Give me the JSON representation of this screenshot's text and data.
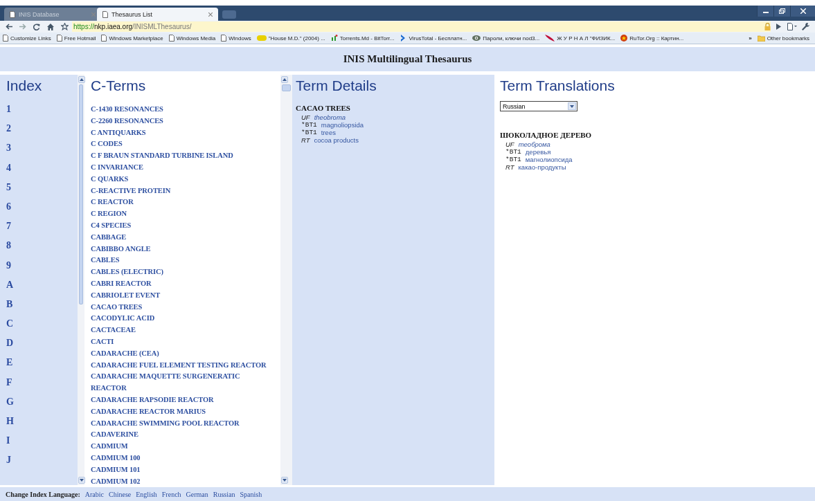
{
  "browser": {
    "tabs": [
      {
        "label": "INIS Database",
        "selected": false
      },
      {
        "label": "Thesaurus List",
        "selected": true
      }
    ],
    "address": {
      "scheme": "https://",
      "host": "nkp.iaea.org",
      "path": "/INISMLThesaurus/"
    },
    "bookmarks": [
      {
        "label": "Customize Links",
        "kind": "page"
      },
      {
        "label": "Free Hotmail",
        "kind": "page"
      },
      {
        "label": "Windows Marketplace",
        "kind": "page"
      },
      {
        "label": "Windows Media",
        "kind": "page"
      },
      {
        "label": "Windows",
        "kind": "page"
      },
      {
        "label": "\"House M.D.\" (2004) ...",
        "kind": "badge",
        "color": "#e8d000"
      },
      {
        "label": "Torrents.Md - BitTorr...",
        "kind": "md",
        "color": "#2a9a2a"
      },
      {
        "label": "VirusTotal - Бесплатн...",
        "kind": "chevron",
        "color": "#1a6ad0"
      },
      {
        "label": "Пароли, ключи nod3...",
        "kind": "eye",
        "color": "#607060"
      },
      {
        "label": "Ж У Р Н А Л \"ФИЗИК...",
        "kind": "feather",
        "color": "#c0103a"
      },
      {
        "label": "RuTor.Org :: Картин...",
        "kind": "star",
        "color": "#d04010"
      }
    ],
    "overflow": "»",
    "other_bookmarks": "Other bookmarks"
  },
  "page": {
    "title": "INIS Multilingual Thesaurus",
    "index": {
      "heading": "Index",
      "items": [
        "1",
        "2",
        "3",
        "4",
        "5",
        "6",
        "7",
        "8",
        "9",
        "A",
        "B",
        "C",
        "D",
        "E",
        "F",
        "G",
        "H",
        "I",
        "J"
      ]
    },
    "terms": {
      "heading": "C-Terms",
      "items": [
        {
          "label": "C-1430 RESONANCES",
          "selected": false
        },
        {
          "label": "C-2260 RESONANCES",
          "selected": false
        },
        {
          "label": "C ANTIQUARKS",
          "selected": false
        },
        {
          "label": "C CODES",
          "selected": false
        },
        {
          "label": "C F BRAUN STANDARD TURBINE ISLAND",
          "selected": false
        },
        {
          "label": "C INVARIANCE",
          "selected": false
        },
        {
          "label": "C QUARKS",
          "selected": false
        },
        {
          "label": "C-REACTIVE PROTEIN",
          "selected": false
        },
        {
          "label": "C REACTOR",
          "selected": false
        },
        {
          "label": "C REGION",
          "selected": false
        },
        {
          "label": "C4 SPECIES",
          "selected": false
        },
        {
          "label": "CABBAGE",
          "selected": false
        },
        {
          "label": "CABIBBO ANGLE",
          "selected": false
        },
        {
          "label": "CABLES",
          "selected": false
        },
        {
          "label": "CABLES (ELECTRIC)",
          "selected": false
        },
        {
          "label": "CABRI REACTOR",
          "selected": false
        },
        {
          "label": "CABRIOLET EVENT",
          "selected": false
        },
        {
          "label": "CACAO TREES",
          "selected": false
        },
        {
          "label": "CACODYLIC ACID",
          "selected": false
        },
        {
          "label": "CACTACEAE",
          "selected": false
        },
        {
          "label": "CACTI",
          "selected": false
        },
        {
          "label": "CADARACHE (CEA)",
          "selected": false
        },
        {
          "label": "CADARACHE FUEL ELEMENT TESTING REACTOR",
          "selected": false
        },
        {
          "label": "CADARACHE MAQUETTE SURGENERATIC REACTOR",
          "selected": false
        },
        {
          "label": "CADARACHE RAPSODIE REACTOR",
          "selected": false
        },
        {
          "label": "CADARACHE REACTOR MARIUS",
          "selected": false
        },
        {
          "label": "CADARACHE SWIMMING POOL REACTOR",
          "selected": false
        },
        {
          "label": "CADAVERINE",
          "selected": false
        },
        {
          "label": "CADMIUM",
          "selected": false
        },
        {
          "label": "CADMIUM 100",
          "selected": false
        },
        {
          "label": "CADMIUM 101",
          "selected": false
        },
        {
          "label": "CADMIUM 102",
          "selected": false
        }
      ]
    },
    "details": {
      "heading": "Term Details",
      "term": "CACAO TREES",
      "relations": [
        {
          "code": "UF",
          "kind": "uf",
          "term": "theobroma"
        },
        {
          "code": "*BT1",
          "kind": "bt",
          "term": "magnoliopsida"
        },
        {
          "code": "*BT1",
          "kind": "bt",
          "term": "trees"
        },
        {
          "code": "RT",
          "kind": "rt",
          "term": "cocoa products"
        }
      ]
    },
    "translations": {
      "heading": "Term Translations",
      "language": "Russian",
      "term": "ШОКОЛАДНОЕ ДЕРЕВО",
      "relations": [
        {
          "code": "UF",
          "kind": "uf",
          "term": "теоброма"
        },
        {
          "code": "*BT1",
          "kind": "bt",
          "term": "деревья"
        },
        {
          "code": "*BT1",
          "kind": "bt",
          "term": "магнолиопсида"
        },
        {
          "code": "RT",
          "kind": "rt",
          "term": "какао-продукты"
        }
      ]
    },
    "footer": {
      "label": "Change Index Language:",
      "languages": [
        "Arabic",
        "Chinese",
        "English",
        "French",
        "German",
        "Russian",
        "Spanish"
      ]
    }
  }
}
